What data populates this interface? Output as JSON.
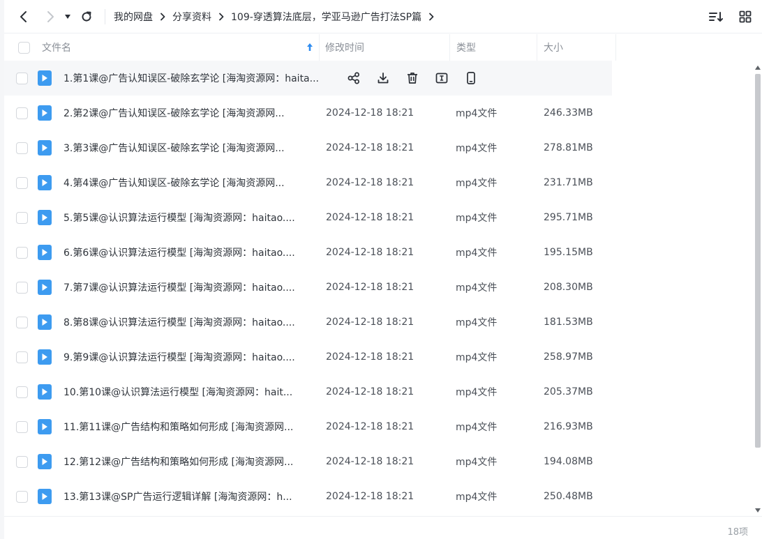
{
  "breadcrumb": [
    "我的网盘",
    "分享资料",
    "109-穿透算法底层，学亚马逊广告打法SP篇"
  ],
  "columns": {
    "name": "文件名",
    "modified": "修改时间",
    "type": "类型",
    "size": "大小"
  },
  "rows": [
    {
      "name": "1.第1课@广告认知误区-破除玄学论 [海淘资源网：haita...",
      "modified": "",
      "type": "",
      "size": ""
    },
    {
      "name": "2.第2课@广告认知误区-破除玄学论 [海淘资源网...",
      "modified": "2024-12-18 18:21",
      "type": "mp4文件",
      "size": "246.33MB"
    },
    {
      "name": "3.第3课@广告认知误区-破除玄学论 [海淘资源网...",
      "modified": "2024-12-18 18:21",
      "type": "mp4文件",
      "size": "278.81MB"
    },
    {
      "name": "4.第4课@广告认知误区-破除玄学论 [海淘资源网...",
      "modified": "2024-12-18 18:21",
      "type": "mp4文件",
      "size": "231.71MB"
    },
    {
      "name": "5.第5课@认识算法运行模型 [海淘资源网：haitao....",
      "modified": "2024-12-18 18:21",
      "type": "mp4文件",
      "size": "295.71MB"
    },
    {
      "name": "6.第6课@认识算法运行模型 [海淘资源网：haitao....",
      "modified": "2024-12-18 18:21",
      "type": "mp4文件",
      "size": "195.15MB"
    },
    {
      "name": "7.第7课@认识算法运行模型 [海淘资源网：haitao....",
      "modified": "2024-12-18 18:21",
      "type": "mp4文件",
      "size": "208.30MB"
    },
    {
      "name": "8.第8课@认识算法运行模型 [海淘资源网：haitao....",
      "modified": "2024-12-18 18:21",
      "type": "mp4文件",
      "size": "181.53MB"
    },
    {
      "name": "9.第9课@认识算法运行模型 [海淘资源网：haitao....",
      "modified": "2024-12-18 18:21",
      "type": "mp4文件",
      "size": "258.97MB"
    },
    {
      "name": "10.第10课@认识算法运行模型 [海淘资源网：hait...",
      "modified": "2024-12-18 18:21",
      "type": "mp4文件",
      "size": "205.37MB"
    },
    {
      "name": "11.第11课@广告结构和策略如何形成 [海淘资源网...",
      "modified": "2024-12-18 18:21",
      "type": "mp4文件",
      "size": "216.93MB"
    },
    {
      "name": "12.第12课@广告结构和策略如何形成 [海淘资源网...",
      "modified": "2024-12-18 18:21",
      "type": "mp4文件",
      "size": "194.08MB"
    },
    {
      "name": "13.第13课@SP广告运行逻辑详解 [海淘资源网：h...",
      "modified": "2024-12-18 18:21",
      "type": "mp4文件",
      "size": "250.48MB"
    }
  ],
  "footer": {
    "count": "18项"
  },
  "icons": {
    "file_type": "video-file-icon",
    "row_actions": [
      "share-icon",
      "download-icon",
      "delete-icon",
      "rename-icon",
      "phone-icon"
    ]
  },
  "colors": {
    "accent": "#3d9bf0",
    "sort_arrow": "#2f8cf0"
  }
}
